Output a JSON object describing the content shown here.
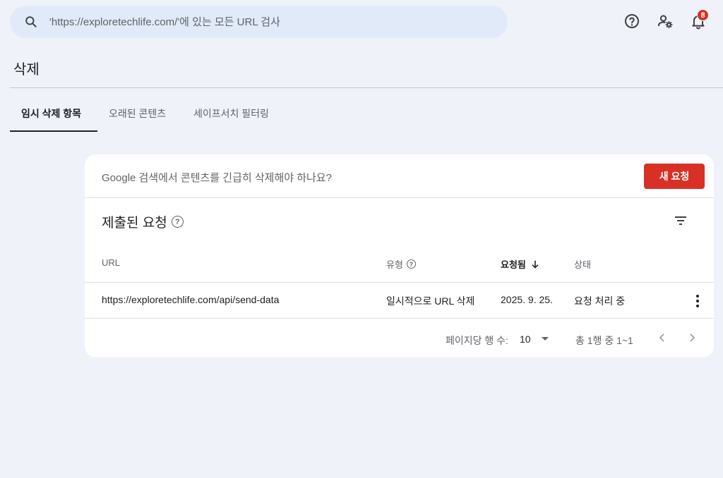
{
  "search": {
    "placeholder": "'https://exploretechlife.com/'에 있는 모든 URL 검사"
  },
  "header": {
    "icons": [
      "help-icon",
      "manage-users-icon",
      "notifications-icon"
    ],
    "notification_count": "8"
  },
  "page": {
    "title": "삭제"
  },
  "tabs": [
    {
      "label": "임시 삭제 항목",
      "active": true
    },
    {
      "label": "오래된 콘텐츠",
      "active": false
    },
    {
      "label": "세이프서치 필터링",
      "active": false
    }
  ],
  "banner": {
    "question": "Google 검색에서 콘텐츠를 긴급히 삭제해야 하나요?",
    "new_request_label": "새 요청"
  },
  "requests": {
    "title": "제출된 요청",
    "help_glyph": "?",
    "columns": {
      "url": "URL",
      "type": "유형",
      "requested": "요청됨",
      "status": "상태"
    },
    "rows": [
      {
        "url": "https://exploretechlife.com/api/send-data",
        "type": "일시적으로 URL 삭제",
        "requested": "2025. 9. 25.",
        "status": "요청 처리 중"
      }
    ]
  },
  "pagination": {
    "rows_per_page_label": "페이지당 행 수:",
    "rows_per_page_value": "10",
    "range_text": "총 1행 중 1~1"
  },
  "colors": {
    "accent_red": "#d93025",
    "background": "#eff3f9",
    "search_bg": "#e1eaf8"
  }
}
